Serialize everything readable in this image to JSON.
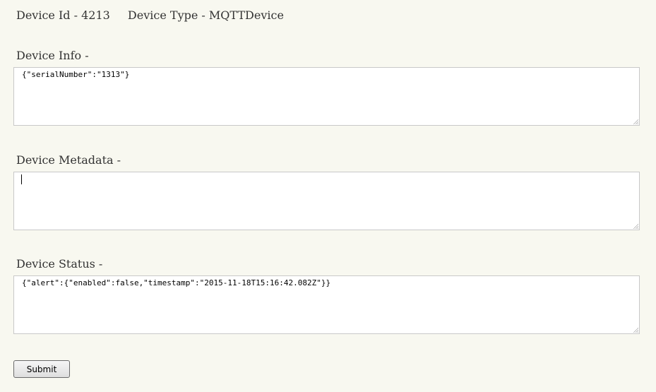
{
  "header": {
    "device_id": "Device Id - 4213",
    "device_type": "Device Type - MQTTDevice"
  },
  "sections": {
    "info": {
      "label": "Device Info -",
      "value": "{\"serialNumber\":\"1313\"}"
    },
    "metadata": {
      "label": "Device Metadata -",
      "value": ""
    },
    "status": {
      "label": "Device Status -",
      "value": "{\"alert\":{\"enabled\":false,\"timestamp\":\"2015-11-18T15:16:42.082Z\"}}"
    }
  },
  "submit": {
    "label": "Submit"
  }
}
